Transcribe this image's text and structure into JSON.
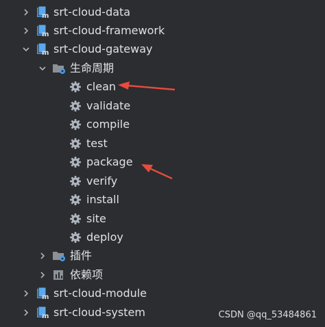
{
  "colors": {
    "background": "#2b2d30",
    "text": "#dfe1e5",
    "module_icon": "#4a9ce8",
    "gear": "#aeb4bd",
    "arrow": "#e84b3c"
  },
  "modules": [
    {
      "label": "srt-cloud-data",
      "icon": "maven-module-icon",
      "expanded": false
    },
    {
      "label": "srt-cloud-framework",
      "icon": "maven-module-icon",
      "expanded": false
    },
    {
      "label": "srt-cloud-gateway",
      "icon": "maven-module-icon",
      "expanded": true
    },
    {
      "label": "srt-cloud-module",
      "icon": "maven-module-icon",
      "expanded": false
    },
    {
      "label": "srt-cloud-system",
      "icon": "maven-module-icon",
      "expanded": false
    }
  ],
  "lifecycle": {
    "label": "生命周期",
    "icon": "folder-gear-icon",
    "expanded": true,
    "goals": [
      "clean",
      "validate",
      "compile",
      "test",
      "package",
      "verify",
      "install",
      "site",
      "deploy"
    ],
    "goal_icon": "gear-icon"
  },
  "plugins": {
    "label": "插件",
    "icon": "folder-gear-icon",
    "expanded": false
  },
  "dependencies": {
    "label": "依赖项",
    "icon": "dependencies-icon",
    "expanded": false
  },
  "annotations": {
    "arrow_targets": [
      "clean",
      "package"
    ]
  },
  "watermark": "CSDN @qq_53484861"
}
